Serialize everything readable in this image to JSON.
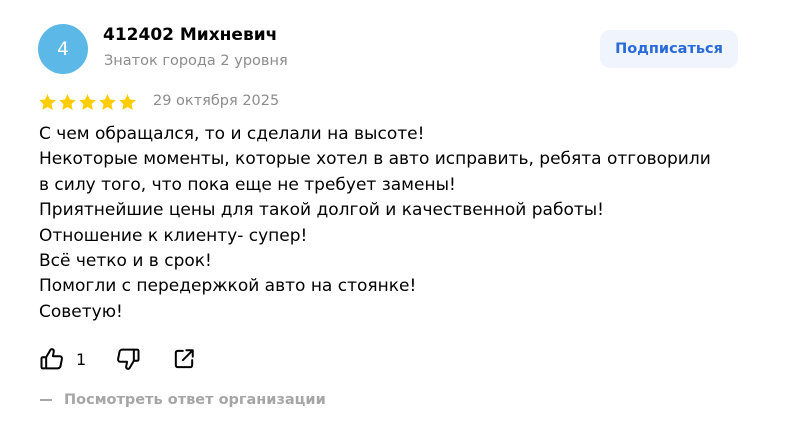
{
  "author": {
    "avatar_letter": "4",
    "name": "412402 Михневич",
    "badge": "Знаток города 2 уровня"
  },
  "subscribe_label": "Подписаться",
  "rating": {
    "stars": 5,
    "max": 5,
    "color": "#ffcc00"
  },
  "date": "29 октября 2025",
  "text_lines": [
    "С чем обращался, то и сделали на высоте!",
    "Некоторые моменты, которые хотел в авто исправить, ребята отговорили",
    "в силу того, что пока еще не требует замены!",
    "Приятнейшие цены для такой долгой и качественной работы!",
    "Отношение к клиенту- супер!",
    "Всё четко и в срок!",
    "Помогли с передержкой авто на стоянке!",
    "Советую!"
  ],
  "actions": {
    "like_icon": "thumbs-up-icon",
    "like_count": "1",
    "dislike_icon": "thumbs-down-icon",
    "share_icon": "share-icon"
  },
  "org_reply_label": "Посмотреть ответ организации",
  "colors": {
    "avatar": "#5cb8e6",
    "subscribe_bg": "#f0f4fc",
    "subscribe_text": "#2a6ad8",
    "muted": "#8c8c8c"
  }
}
